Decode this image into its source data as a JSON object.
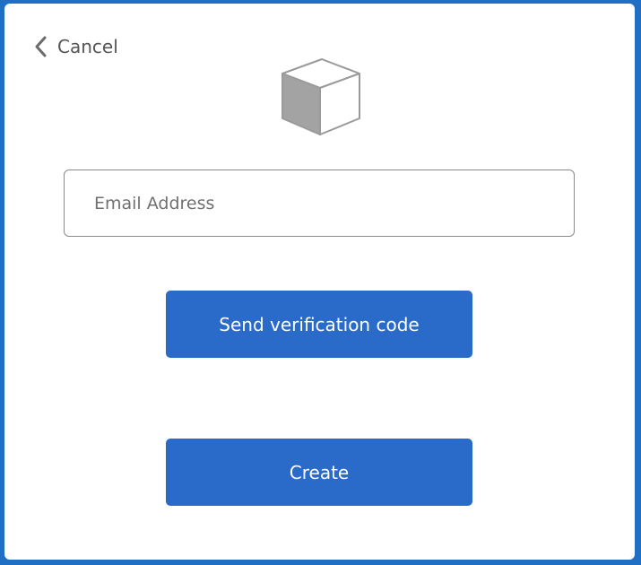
{
  "nav": {
    "cancel_label": "Cancel"
  },
  "form": {
    "email_placeholder": "Email Address",
    "email_value": ""
  },
  "buttons": {
    "send_code_label": "Send verification code",
    "create_label": "Create"
  },
  "icons": {
    "back": "chevron-left-icon",
    "logo": "cube-icon"
  },
  "colors": {
    "accent": "#2a6ac8",
    "window_border": "#1f6fc5",
    "text_muted": "#707070"
  }
}
